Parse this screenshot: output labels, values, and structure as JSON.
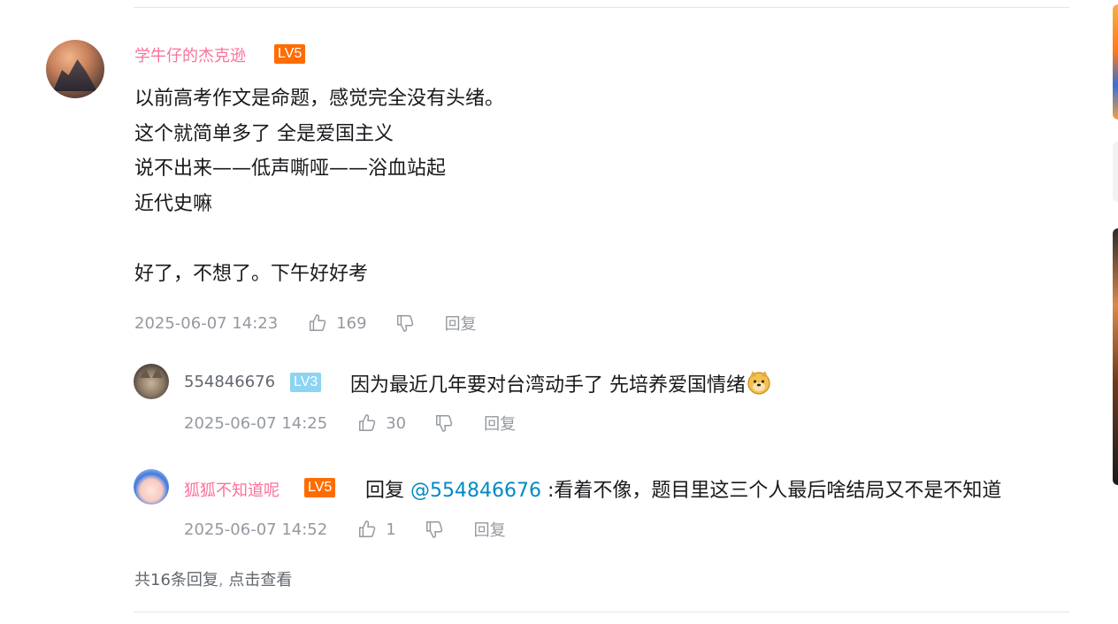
{
  "main_comment": {
    "username": "学牛仔的杰克逊",
    "level": "LV5",
    "lines": [
      "以前高考作文是命题，感觉完全没有头绪。",
      "这个就简单多了 全是爱国主义",
      "说不出来——低声嘶哑——浴血站起",
      "近代史嘛",
      "",
      "好了，不想了。下午好好考"
    ],
    "time": "2025-06-07 14:23",
    "likes": "169",
    "reply_label": "回复"
  },
  "replies": [
    {
      "username": "554846676",
      "level": "LV3",
      "text": "因为最近几年要对台湾动手了 先培养爱国情绪",
      "emoji": "doge-emoji",
      "time": "2025-06-07 14:25",
      "likes": "30",
      "reply_label": "回复"
    },
    {
      "username": "狐狐不知道呢",
      "level": "LV5",
      "prefix": "回复 ",
      "mention": "@554846676",
      "text": " :看着不像，题目里这三个人最后啥结局又不是不知道",
      "time": "2025-06-07 14:52",
      "likes": "1",
      "reply_label": "回复"
    }
  ],
  "summary": {
    "count_text": "共16条回复",
    "sep": ", ",
    "action": "点击查看"
  },
  "icons": {
    "like": "thumbs-up-icon",
    "dislike": "thumbs-down-icon"
  },
  "colors": {
    "username_vip": "#fb7299",
    "username_normal": "#61666d",
    "level5": "#ff6c00",
    "level3": "#8bd4f3",
    "mention": "#008ac5",
    "meta": "#9499a0"
  }
}
